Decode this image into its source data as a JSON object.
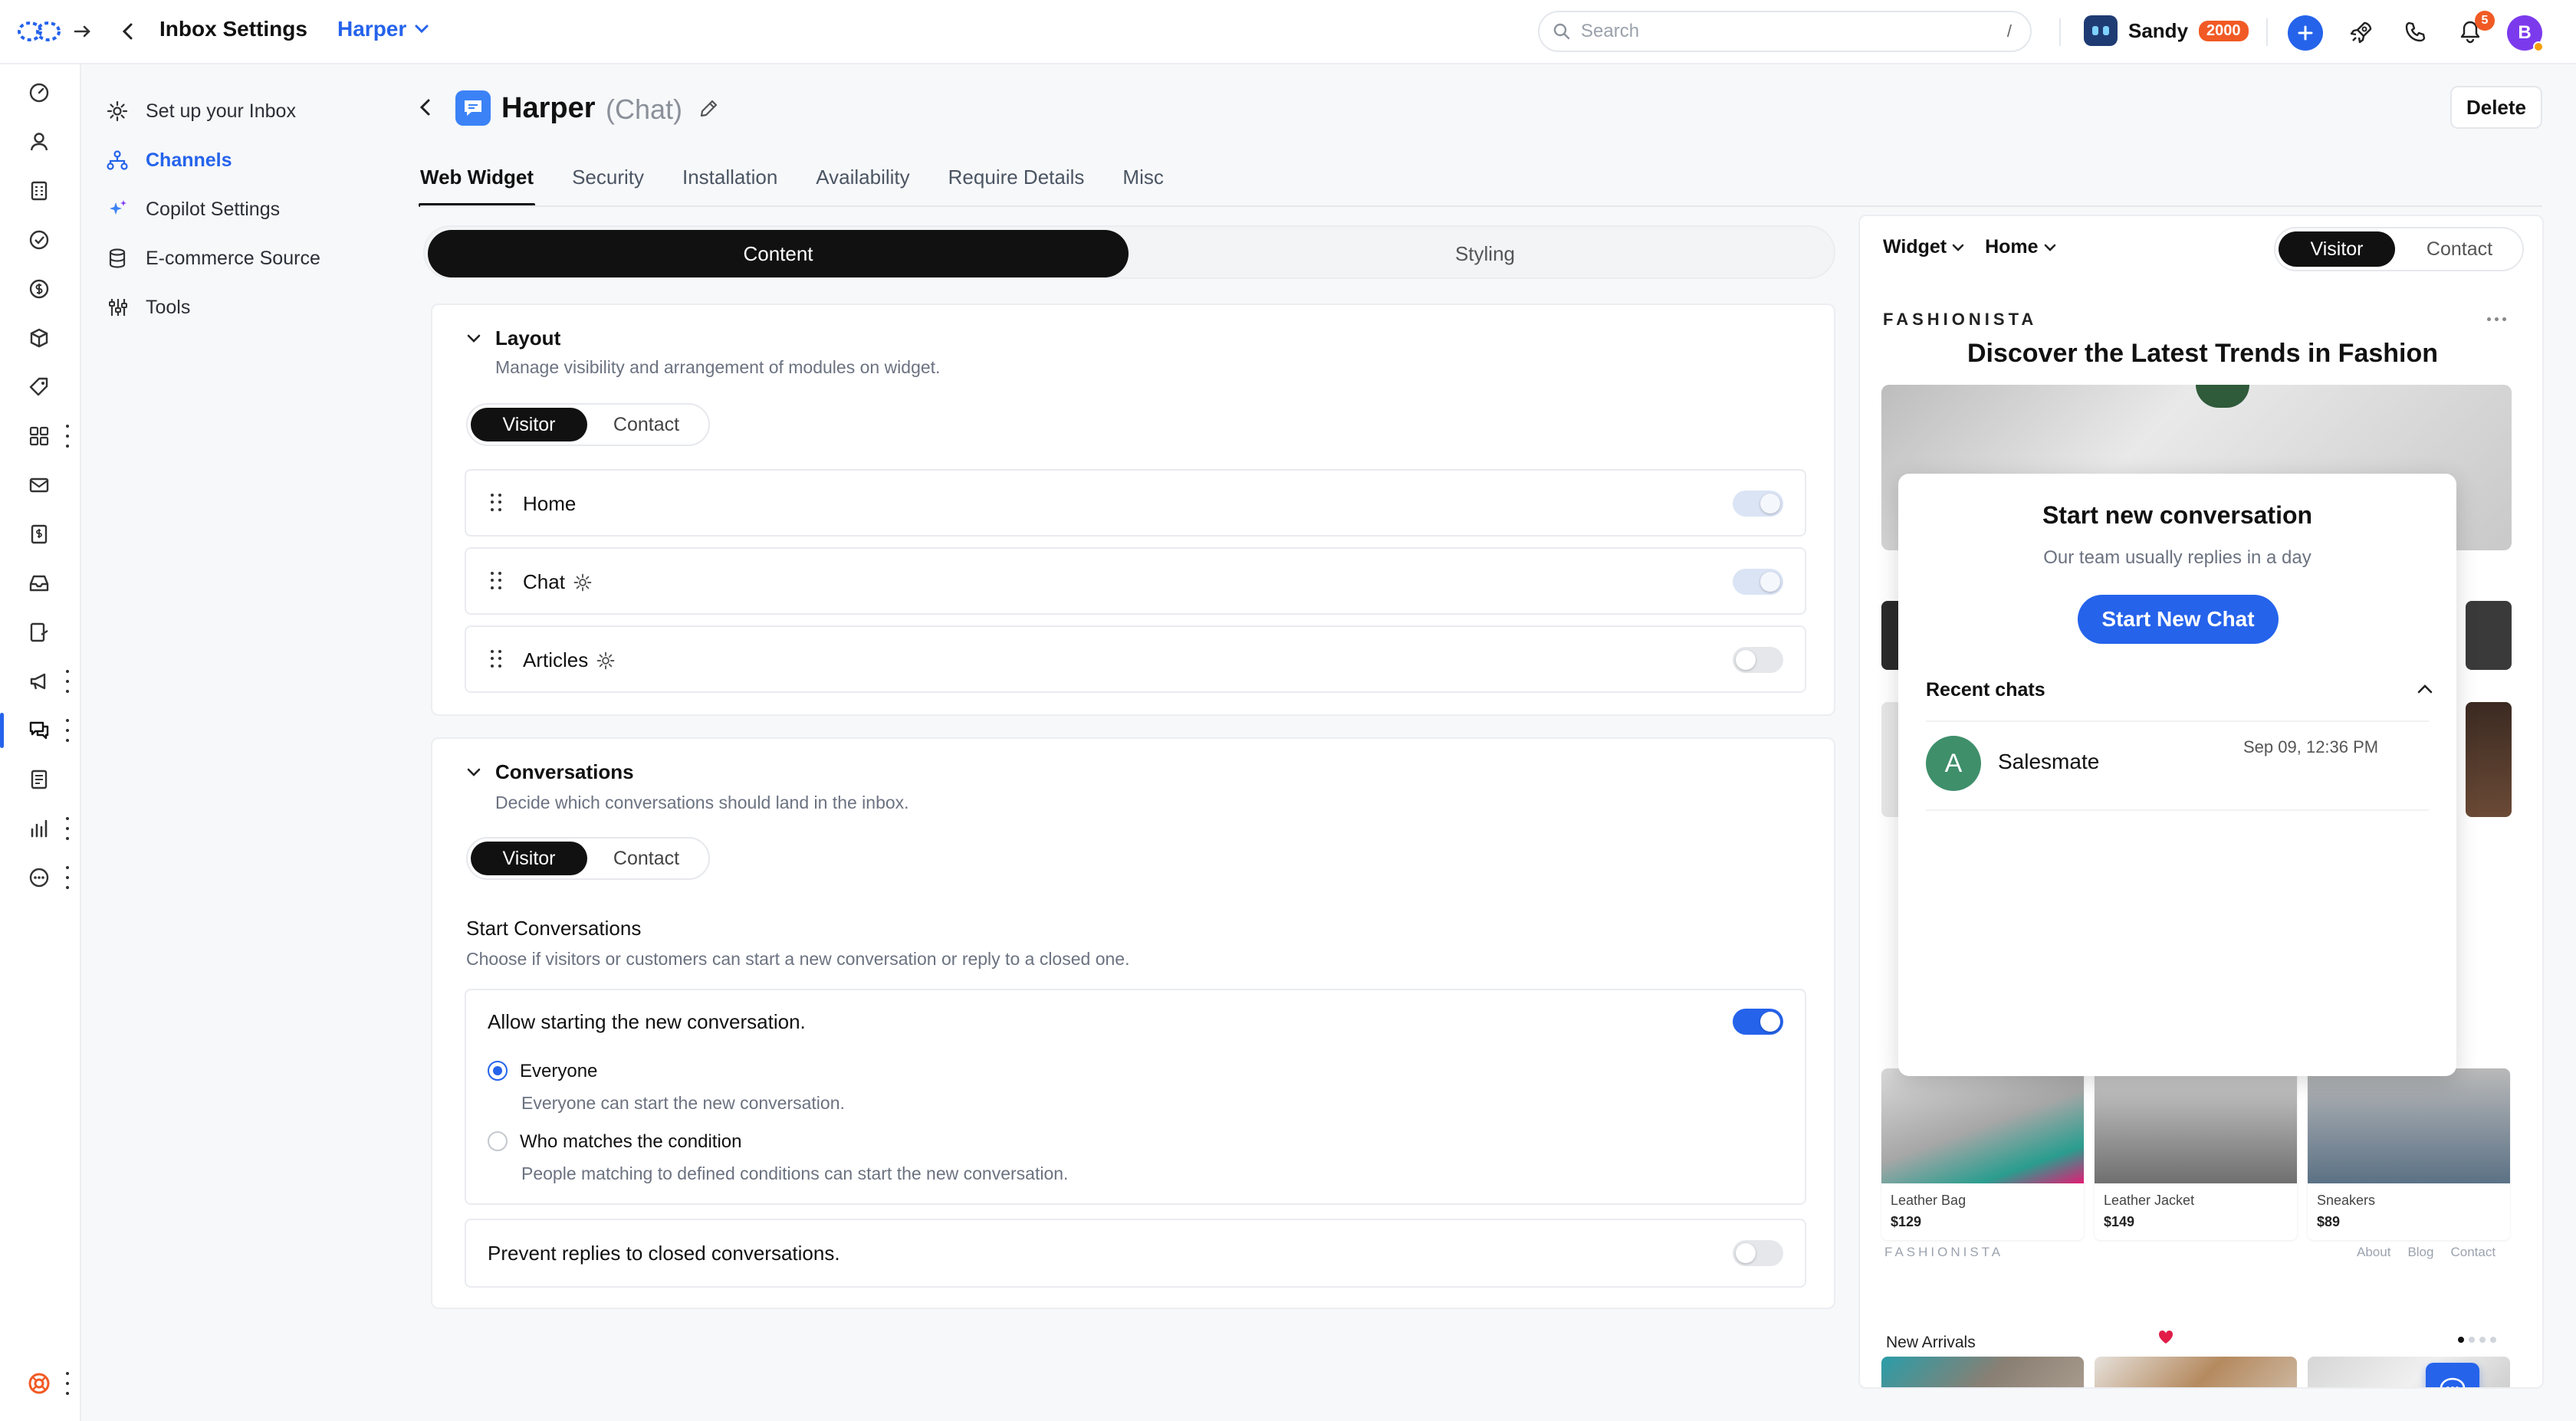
{
  "topbar": {
    "title": "Inbox Settings",
    "inbox_name": "Harper",
    "search_placeholder": "Search",
    "search_shortcut": "/",
    "user_name": "Sandy",
    "user_credits": "2000",
    "notification_count": "5",
    "profile_initial": "B"
  },
  "settings_nav": {
    "items": [
      {
        "label": "Set up your Inbox",
        "icon": "gear-icon"
      },
      {
        "label": "Channels",
        "icon": "channels-icon",
        "active": true
      },
      {
        "label": "Copilot Settings",
        "icon": "sparkle-icon"
      },
      {
        "label": "E-commerce Source",
        "icon": "database-icon"
      },
      {
        "label": "Tools",
        "icon": "tools-icon"
      }
    ]
  },
  "channel": {
    "name": "Harper",
    "type": "(Chat)",
    "delete_label": "Delete"
  },
  "tabs": [
    "Web Widget",
    "Security",
    "Installation",
    "Availability",
    "Require Details",
    "Misc"
  ],
  "segment": {
    "content": "Content",
    "styling": "Styling"
  },
  "layout": {
    "title": "Layout",
    "description": "Manage visibility and arrangement of modules on widget.",
    "visitor": "Visitor",
    "contact": "Contact",
    "modules": [
      {
        "label": "Home",
        "toggle": "on-disabled"
      },
      {
        "label": "Chat",
        "toggle": "on-disabled",
        "gear": true
      },
      {
        "label": "Articles",
        "toggle": "off",
        "gear": true
      }
    ]
  },
  "conversations": {
    "title": "Conversations",
    "description": "Decide which conversations should land in the inbox.",
    "visitor": "Visitor",
    "contact": "Contact",
    "start_title": "Start Conversations",
    "start_desc": "Choose if visitors or customers can start a new conversation or reply to a closed one.",
    "allow_label": "Allow starting the new conversation.",
    "allow_on": true,
    "option_everyone": "Everyone",
    "option_everyone_desc": "Everyone can start the new conversation.",
    "option_condition": "Who matches the condition",
    "option_condition_desc": "People matching to defined conditions can start the new conversation.",
    "selected_option": "Everyone",
    "prevent_label": "Prevent replies to closed conversations.",
    "prevent_on": false
  },
  "preview": {
    "widget_select": "Widget",
    "page_select": "Home",
    "visitor": "Visitor",
    "contact": "Contact",
    "site_brand": "FASHIONISTA",
    "hero_title": "Discover the Latest Trends in Fashion",
    "widget_title": "Start new conversation",
    "widget_sub": "Our team usually replies in a day",
    "widget_button": "Start New Chat",
    "recent_chats": "Recent chats",
    "chat_avatar": "A",
    "chat_name": "Salesmate",
    "chat_time": "Sep 09, 12:36 PM",
    "products": [
      {
        "name": "Leather Bag",
        "price": "$129"
      },
      {
        "name": "Leather Jacket",
        "price": "$149"
      },
      {
        "name": "Sneakers",
        "price": "$89"
      }
    ],
    "new_arrivals": "New Arrivals",
    "footer_brand": "FASHIONISTA",
    "footer_links": [
      "About",
      "Blog",
      "Contact"
    ]
  },
  "colors": {
    "accent": "#2563eb",
    "credits_badge": "#f15a24",
    "avatar_green": "#3f8f6b"
  }
}
